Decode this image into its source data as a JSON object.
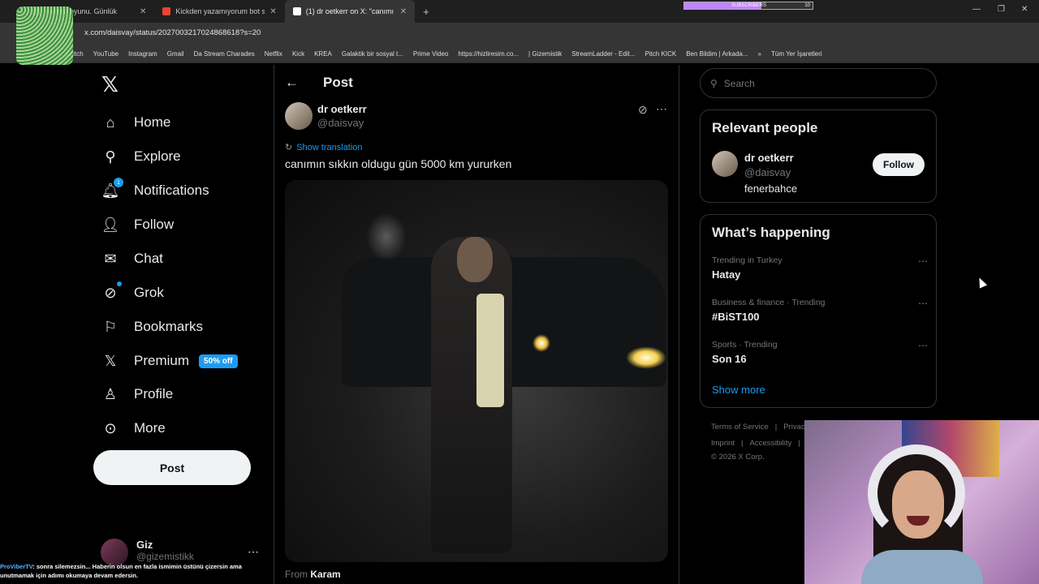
{
  "browser": {
    "tabs": [
      {
        "label": "Kelime oyunu. Günlük",
        "close": "✕"
      },
      {
        "label": "Kickden yazamıyorum bot sanıy",
        "close": "✕"
      },
      {
        "label": "(1) dr oetkerr on X: \"canımı",
        "close": "✕"
      }
    ],
    "new_tab": "+",
    "url": "x.com/daisvay/status/2027003217024868618?s=20",
    "subscribers_label": "SUBSCRIBERS",
    "subscribers_count": "10",
    "bookmarks": [
      "Twitch",
      "YouTube",
      "Instagram",
      "Gmail",
      "Da Stream Charades",
      "Netflix",
      "Kick",
      "KREA",
      "Galaktik bir sosyal t...",
      "Prime Video",
      "https://hizliresim.co...",
      "| Gizemistik",
      "StreamLadder - Edit...",
      "Pitch KICK",
      "Ben Bildim | Arkada..."
    ],
    "bookmarks_more": "»",
    "all_bookmarks": "Tüm Yer İşaretleri",
    "win_min": "—",
    "win_max": "❐",
    "win_close": "✕"
  },
  "nav": {
    "logo": "𝕏",
    "items": [
      {
        "label": "Home",
        "icon": "home-icon"
      },
      {
        "label": "Explore",
        "icon": "search-icon"
      },
      {
        "label": "Notifications",
        "icon": "bell-icon",
        "badge": "1"
      },
      {
        "label": "Follow",
        "icon": "follow-icon"
      },
      {
        "label": "Chat",
        "icon": "mail-icon"
      },
      {
        "label": "Grok",
        "icon": "grok-icon"
      },
      {
        "label": "Bookmarks",
        "icon": "bookmark-icon"
      },
      {
        "label": "Premium",
        "icon": "x-icon",
        "badge": "50% off"
      },
      {
        "label": "Profile",
        "icon": "person-icon"
      },
      {
        "label": "More",
        "icon": "more-icon"
      }
    ],
    "post_button": "Post",
    "account": {
      "name": "Giz",
      "handle": "@gizemistikk",
      "menu": "⋯"
    }
  },
  "ticker": {
    "name": "ProViberTV",
    "text": ": sonra silemezsin... Haberin olsun en fazla ismimin üstünü çizersin ama unutmamak için adımı okumaya devam edersin."
  },
  "post": {
    "header": "Post",
    "back": "←",
    "author_name": "dr oetkerr",
    "author_handle": "@daisvay",
    "show_translation": "Show translation",
    "text": "canımın sıkkın oldugu gün 5000 km yururken",
    "from_label": "From",
    "from_name": "Karam"
  },
  "right": {
    "search_placeholder": "Search",
    "relevant_title": "Relevant people",
    "person": {
      "name": "dr oetkerr",
      "handle": "@daisvay",
      "bio": "fenerbahce",
      "follow": "Follow"
    },
    "happening_title": "What’s happening",
    "trends": [
      {
        "context": "Trending in Turkey",
        "topic": "Hatay"
      },
      {
        "context": "Business & finance · Trending",
        "topic": "#BiST100"
      },
      {
        "context": "Sports · Trending",
        "topic": "Son 16"
      }
    ],
    "show_more": "Show more",
    "footer": {
      "tos": "Terms of Service",
      "privacy": "Privac",
      "imprint": "Imprint",
      "accessibility": "Accessibility",
      "copyright": "© 2026 X Corp."
    }
  },
  "colors": {
    "accent": "#1d9bf0",
    "bg": "#000000",
    "border": "#2f3336",
    "muted": "#71767b"
  }
}
